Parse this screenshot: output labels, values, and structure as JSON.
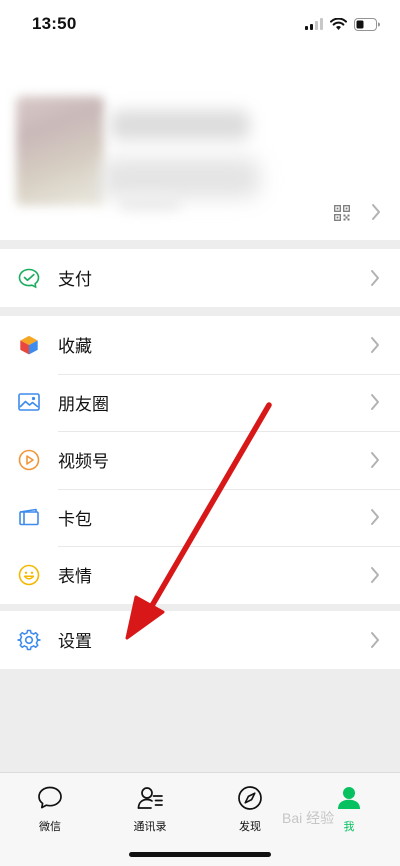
{
  "status_bar": {
    "time": "13:50"
  },
  "menu": {
    "pay": {
      "label": "支付"
    },
    "items": [
      {
        "label": "收藏",
        "icon": "favorites-cube-icon"
      },
      {
        "label": "朋友圈",
        "icon": "moments-image-icon"
      },
      {
        "label": "视频号",
        "icon": "channels-play-icon"
      },
      {
        "label": "卡包",
        "icon": "card-wallet-icon"
      },
      {
        "label": "表情",
        "icon": "stickers-smile-icon"
      }
    ],
    "settings": {
      "label": "设置"
    }
  },
  "tabbar": {
    "tabs": [
      {
        "label": "微信",
        "icon": "chat-bubble-icon"
      },
      {
        "label": "通讯录",
        "icon": "contacts-icon"
      },
      {
        "label": "发现",
        "icon": "compass-icon"
      },
      {
        "label": "我",
        "icon": "me-person-icon",
        "active": true
      }
    ]
  },
  "watermark": {
    "text": "Bai 经验"
  },
  "colors": {
    "accent": "#07c160",
    "annotation_arrow": "#e31b1b",
    "page_bg": "#ededed"
  }
}
